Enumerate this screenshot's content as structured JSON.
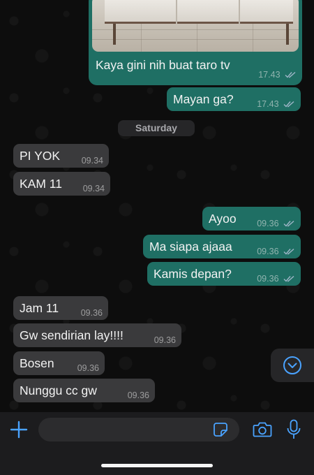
{
  "colors": {
    "outgoing_bubble": "#1f6f64",
    "incoming_bubble": "#3a3a3c",
    "accent_blue": "#4aa3ff",
    "background": "#0d0d0d"
  },
  "chat": {
    "image_message": {
      "caption": "Kaya gini nih buat taro tv",
      "time": "17.43",
      "status_icon": "double-check-icon"
    },
    "messages": [
      {
        "direction": "out",
        "text": "Mayan ga?",
        "time": "17.43"
      }
    ],
    "date_separator": "Saturday",
    "saturday_messages": [
      {
        "direction": "in",
        "text": "PI YOK",
        "time": "09.34"
      },
      {
        "direction": "in",
        "text": "KAM 11",
        "time": "09.34"
      },
      {
        "direction": "out",
        "text": "Ayoo",
        "time": "09.36"
      },
      {
        "direction": "out",
        "text": "Ma siapa ajaaa",
        "time": "09.36"
      },
      {
        "direction": "out",
        "text": "Kamis depan?",
        "time": "09.36"
      },
      {
        "direction": "in",
        "text": "Jam 11",
        "time": "09.36"
      },
      {
        "direction": "in",
        "text": "Gw sendirian lay!!!!",
        "time": "09.36"
      },
      {
        "direction": "in",
        "text": "Bosen",
        "time": "09.36"
      },
      {
        "direction": "in",
        "text": "Nunggu cc gw",
        "time": "09.36"
      }
    ]
  },
  "composer": {
    "placeholder": "",
    "icons": [
      "plus-icon",
      "sticker-icon",
      "camera-icon",
      "microphone-icon"
    ]
  },
  "scroll_down_icon": "chevron-down-circle-icon"
}
